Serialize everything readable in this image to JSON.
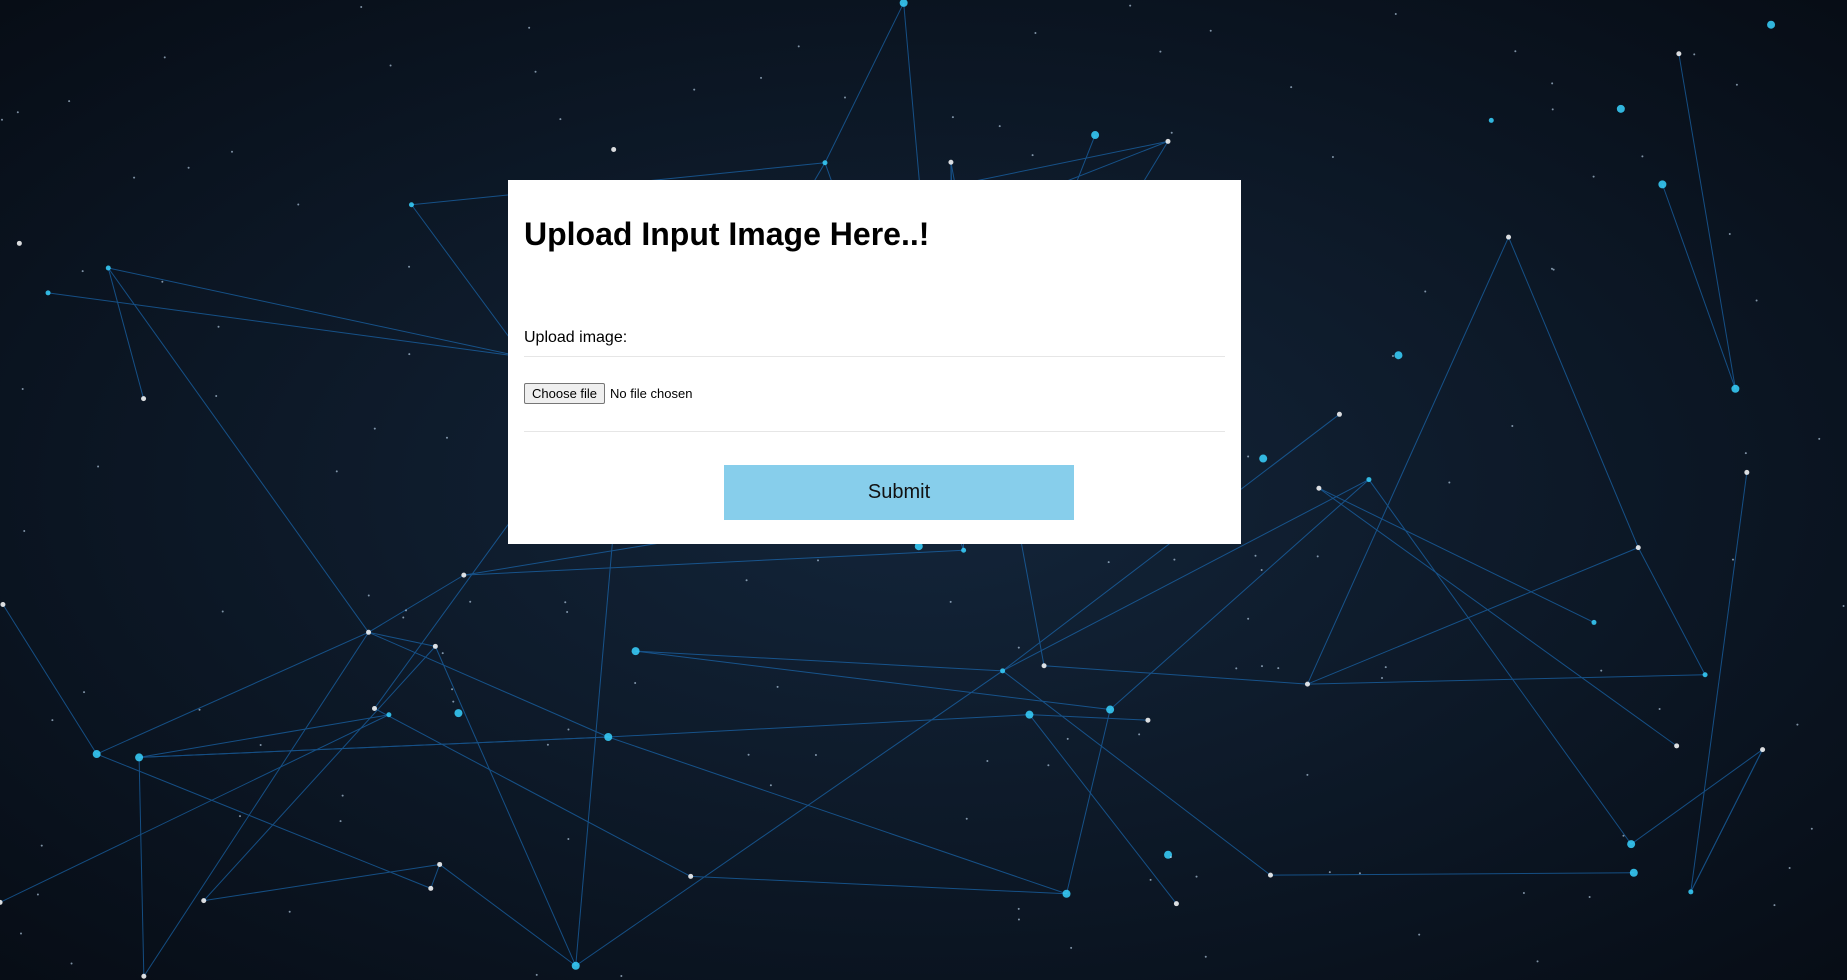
{
  "page": {
    "background_color": "#0b1420",
    "accent_lines_color": "#1e7fd6",
    "node_glow_color": "#38d2ff"
  },
  "form": {
    "title": "Upload Input Image Here..!",
    "upload_label": "Upload image:",
    "file_input": {
      "button_label": "Choose file",
      "status_text": "No file chosen"
    },
    "submit_label": "Submit",
    "submit_color": "#87ceeb"
  }
}
